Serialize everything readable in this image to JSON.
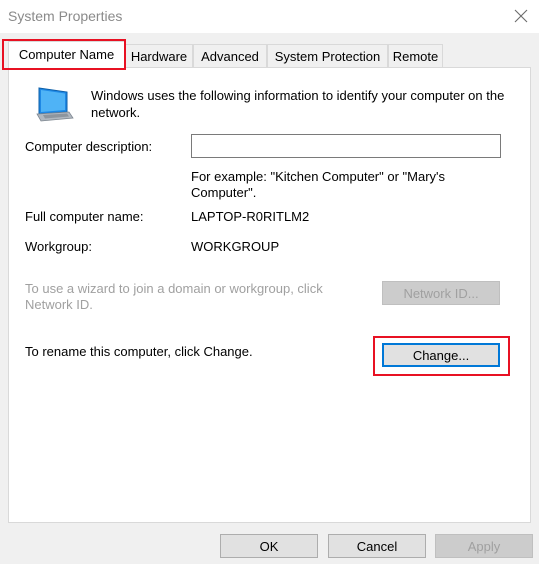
{
  "window": {
    "title": "System Properties"
  },
  "tabs": [
    {
      "label": "Computer Name",
      "active": true
    },
    {
      "label": "Hardware",
      "active": false
    },
    {
      "label": "Advanced",
      "active": false
    },
    {
      "label": "System Protection",
      "active": false
    },
    {
      "label": "Remote",
      "active": false
    }
  ],
  "computer_name_tab": {
    "intro": "Windows uses the following information to identify your computer on the network.",
    "description_label": "Computer description:",
    "description_value": "",
    "description_hint": "For example: \"Kitchen Computer\" or \"Mary's Computer\".",
    "full_name_label": "Full computer name:",
    "full_name_value": "LAPTOP-R0RITLM2",
    "workgroup_label": "Workgroup:",
    "workgroup_value": "WORKGROUP",
    "wizard_text": "To use a wizard to join a domain or workgroup, click Network ID.",
    "network_id_button": "Network ID...",
    "rename_text": "To rename this computer, click Change.",
    "change_button": "Change..."
  },
  "footer": {
    "ok": "OK",
    "cancel": "Cancel",
    "apply": "Apply"
  },
  "colors": {
    "highlight": "#e81123",
    "focus": "#0078d7",
    "disabled_text": "#a0a0a0"
  },
  "icons": {
    "computer": "computer-icon",
    "close": "close-icon"
  }
}
